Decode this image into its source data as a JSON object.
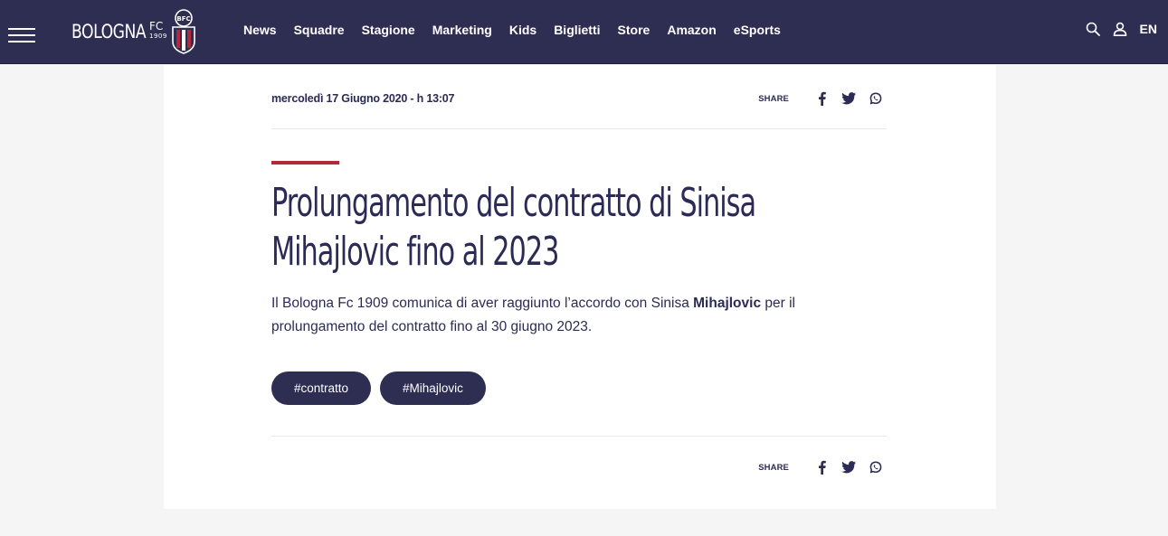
{
  "header": {
    "logo_text": "BOLOGNA",
    "logo_fc": "FC",
    "logo_year": "1909",
    "crest_text": "BFC",
    "nav": [
      "News",
      "Squadre",
      "Stagione",
      "Marketing",
      "Kids",
      "Biglietti",
      "Store",
      "Amazon",
      "eSports"
    ],
    "language": "EN"
  },
  "article": {
    "date": "mercoledì 17 Giugno 2020 - h 13:07",
    "share_label": "SHARE",
    "title": "Prolungamento del contratto di Sinisa Mihajlovic fino al 2023",
    "lead_pre": "Il Bologna Fc 1909 comunica di aver raggiunto l’accordo con Sinisa ",
    "lead_bold": "Mihajlovic",
    "lead_post": " per il prolungamento del contratto fino al 30 giugno 2023.",
    "tags": [
      "#contratto",
      "#Mihajlovic"
    ]
  },
  "colors": {
    "header_bg": "#2e2d52",
    "accent_red": "#b02a37",
    "text": "#2b2b55"
  }
}
